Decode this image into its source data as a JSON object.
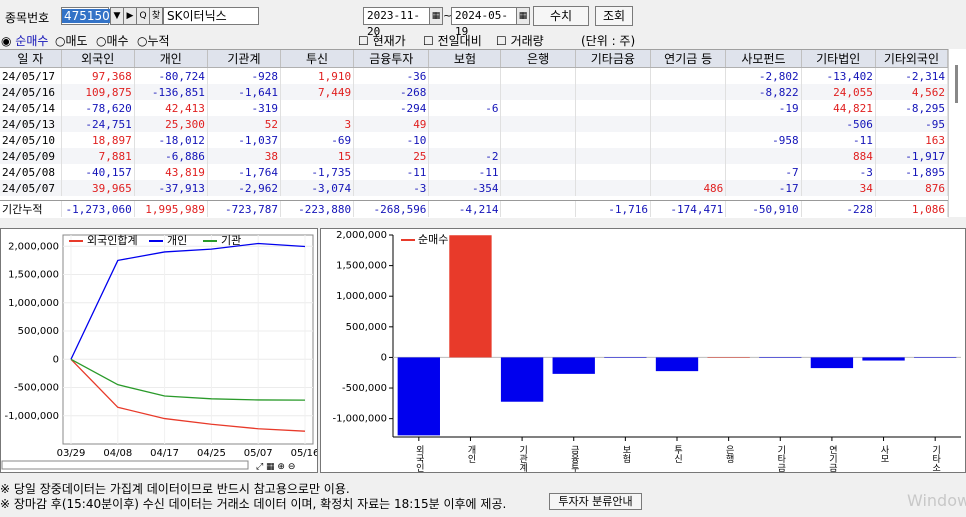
{
  "topbar": {
    "code_label": "종목번호",
    "code_value": "475150",
    "search_icon": "search-icon",
    "name_btn": "찾",
    "stock_name": "SK이터닉스",
    "date_from": "2023-11-20",
    "date_sep": "~",
    "date_to": "2024-05-19",
    "edit_btn": "수치",
    "query_btn": "조회"
  },
  "options": {
    "radios": [
      "순매수",
      "매도",
      "매수",
      "누적"
    ],
    "checks": [
      "현재가",
      "전일대비",
      "거래량"
    ],
    "unit": "(단위 : 주)"
  },
  "table": {
    "headers": [
      "일 자",
      "외국인",
      "개인",
      "기관계",
      "투신",
      "금융투자",
      "보험",
      "은행",
      "기타금융",
      "연기금 등",
      "사모펀드",
      "기타법인",
      "기타외국인"
    ],
    "rows": [
      [
        "24/05/17",
        "97,368",
        "-80,724",
        "-928",
        "1,910",
        "-36",
        "",
        "",
        "",
        "",
        "-2,802",
        "-13,402",
        "-2,314"
      ],
      [
        "24/05/16",
        "109,875",
        "-136,851",
        "-1,641",
        "7,449",
        "-268",
        "",
        "",
        "",
        "",
        "-8,822",
        "24,055",
        "4,562"
      ],
      [
        "24/05/14",
        "-78,620",
        "42,413",
        "-319",
        "",
        "-294",
        "-6",
        "",
        "",
        "",
        "-19",
        "44,821",
        "-8,295"
      ],
      [
        "24/05/13",
        "-24,751",
        "25,300",
        "52",
        "3",
        "49",
        "",
        "",
        "",
        "",
        "",
        "-506",
        "-95"
      ],
      [
        "24/05/10",
        "18,897",
        "-18,012",
        "-1,037",
        "-69",
        "-10",
        "",
        "",
        "",
        "",
        "-958",
        "-11",
        "163"
      ],
      [
        "24/05/09",
        "7,881",
        "-6,886",
        "38",
        "15",
        "25",
        "-2",
        "",
        "",
        "",
        "",
        "884",
        "-1,917"
      ],
      [
        "24/05/08",
        "-40,157",
        "43,819",
        "-1,764",
        "-1,735",
        "-11",
        "-11",
        "",
        "",
        "",
        "-7",
        "-3",
        "-1,895"
      ],
      [
        "24/05/07",
        "39,965",
        "-37,913",
        "-2,962",
        "-3,074",
        "-3",
        "-354",
        "",
        "",
        "486",
        "-17",
        "34",
        "876"
      ]
    ],
    "total": [
      "기간누적",
      "-1,273,060",
      "1,995,989",
      "-723,787",
      "-223,880",
      "-268,596",
      "-4,214",
      "",
      "-1,716",
      "-174,471",
      "-50,910",
      "-228",
      "1,086"
    ]
  },
  "line_chart": {
    "legend": [
      "외국인합계",
      "개인",
      "기관"
    ],
    "yticks": [
      "2,000,000",
      "1,500,000",
      "1,000,000",
      "500,000",
      "0",
      "-500,000",
      "-1,000,000"
    ],
    "xticks": [
      "03/29",
      "04/08",
      "04/17",
      "04/25",
      "05/07",
      "05/16"
    ]
  },
  "bar_chart": {
    "legend": "순매수",
    "yticks": [
      "2,000,000",
      "1,500,000",
      "1,000,000",
      "500,000",
      "0",
      "-500,000",
      "-1,000,000"
    ],
    "xlabels": [
      "외국인",
      "개인",
      "기관계",
      "금융투자",
      "보험",
      "투신",
      "은행",
      "기타금융",
      "연기금",
      "사모",
      "기타소"
    ]
  },
  "chart_data": [
    {
      "type": "line",
      "legend_labels": [
        "외국인합계",
        "개인",
        "기관"
      ],
      "x": [
        "03/29",
        "04/08",
        "04/17",
        "04/25",
        "05/07",
        "05/16"
      ],
      "series": [
        {
          "name": "외국인합계",
          "values": [
            0,
            -850000,
            -1050000,
            -1150000,
            -1230000,
            -1273060
          ]
        },
        {
          "name": "개인",
          "values": [
            0,
            1750000,
            1900000,
            1950000,
            2050000,
            1995989
          ]
        },
        {
          "name": "기관",
          "values": [
            0,
            -450000,
            -650000,
            -700000,
            -720000,
            -723787
          ]
        }
      ],
      "ylim": [
        -1500000,
        2200000
      ]
    },
    {
      "type": "bar",
      "legend_labels": [
        "순매수"
      ],
      "categories": [
        "외국인",
        "개인",
        "기관계",
        "금융투자",
        "보험",
        "투신",
        "은행",
        "기타금융",
        "연기금",
        "사모",
        "기타소"
      ],
      "values": [
        -1273060,
        1995989,
        -723787,
        -268596,
        -4214,
        -223880,
        0,
        -1716,
        -174471,
        -50910,
        -228
      ],
      "ylim": [
        -1300000,
        2000000
      ]
    }
  ],
  "footer": {
    "note1": "※ 당일 장중데이터는 가집계 데이터이므로 반드시 참고용으로만 이용.",
    "note2": "※ 장마감 후(15:40분이후) 수신 데이터는 거래소 데이터 이며, 확정치 자료는 18:15분 이후에 제공.",
    "guide_btn": "투자자 분류안내",
    "watermark": "Window"
  },
  "colors": {
    "red": "#e83a2a",
    "blue": "#0000ee",
    "green": "#2a9a2a"
  }
}
